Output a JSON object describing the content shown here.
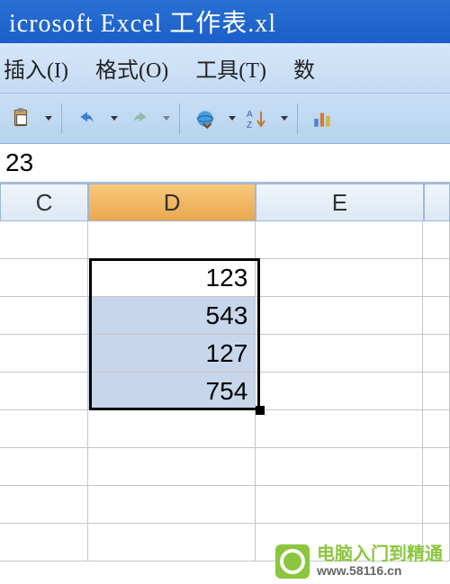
{
  "title": "icrosoft Excel 工作表.xl",
  "menu": {
    "insert": "插入(I)",
    "format": "格式(O)",
    "tools": "工具(T)",
    "data": "数"
  },
  "formula_value": "23",
  "columns": {
    "c": "C",
    "d": "D",
    "e": "E"
  },
  "chart_data": {
    "type": "table",
    "columns": [
      "D"
    ],
    "rows": [
      {
        "D": 123
      },
      {
        "D": 543
      },
      {
        "D": 127
      },
      {
        "D": 754
      }
    ],
    "selected_range": "D2:D5",
    "active_cell": "D2"
  },
  "cells": {
    "d2": "123",
    "d3": "543",
    "d4": "127",
    "d5": "754"
  },
  "watermark": {
    "text": "电脑入门到精通",
    "url": "www.58116.cn"
  }
}
